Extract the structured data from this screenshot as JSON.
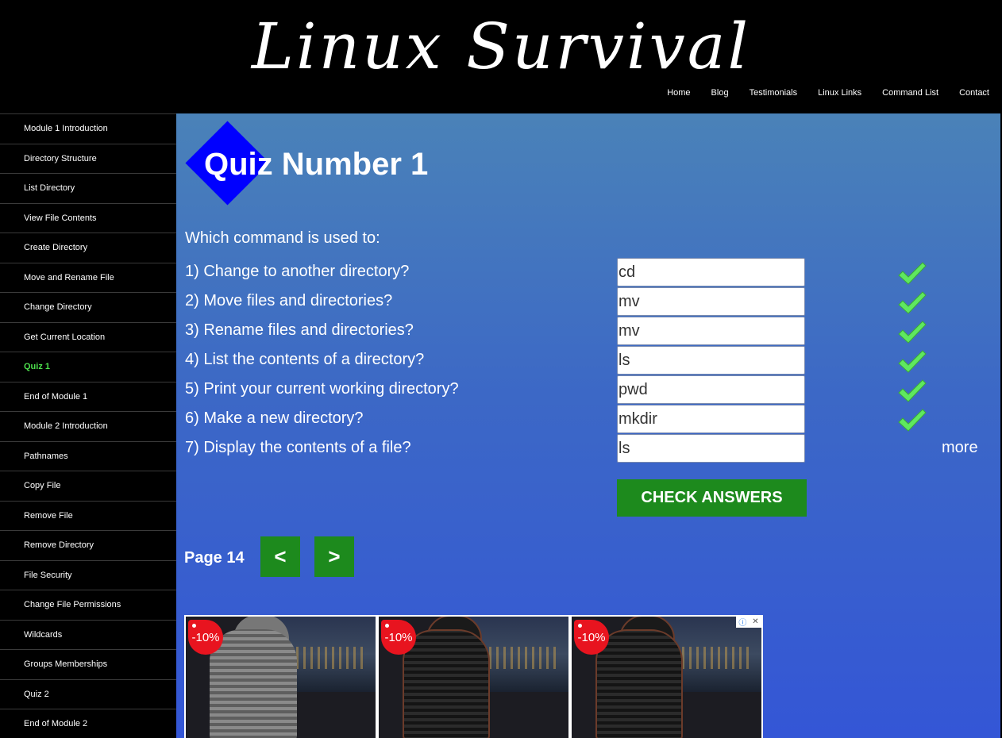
{
  "site": {
    "title": "Linux Survival"
  },
  "nav": [
    "Home",
    "Blog",
    "Testimonials",
    "Linux Links",
    "Command List",
    "Contact"
  ],
  "sidebar": [
    {
      "label": "Module 1 Introduction",
      "active": false
    },
    {
      "label": "Directory Structure",
      "active": false
    },
    {
      "label": "List Directory",
      "active": false
    },
    {
      "label": "View File Contents",
      "active": false
    },
    {
      "label": "Create Directory",
      "active": false
    },
    {
      "label": "Move and Rename File",
      "active": false
    },
    {
      "label": "Change Directory",
      "active": false
    },
    {
      "label": "Get Current Location",
      "active": false
    },
    {
      "label": "Quiz 1",
      "active": true
    },
    {
      "label": "End of Module 1",
      "active": false
    },
    {
      "label": "Module 2 Introduction",
      "active": false
    },
    {
      "label": "Pathnames",
      "active": false
    },
    {
      "label": "Copy File",
      "active": false
    },
    {
      "label": "Remove File",
      "active": false
    },
    {
      "label": "Remove Directory",
      "active": false
    },
    {
      "label": "File Security",
      "active": false
    },
    {
      "label": "Change File Permissions",
      "active": false
    },
    {
      "label": "Wildcards",
      "active": false
    },
    {
      "label": "Groups Memberships",
      "active": false
    },
    {
      "label": "Quiz 2",
      "active": false
    },
    {
      "label": "End of Module 2",
      "active": false
    }
  ],
  "quiz": {
    "title": "Quiz Number 1",
    "prompt": "Which command is used to:",
    "questions": [
      {
        "text": "1) Change to another directory?",
        "answer": "cd",
        "correct": true
      },
      {
        "text": "2) Move files and directories?",
        "answer": "mv",
        "correct": true
      },
      {
        "text": "3) Rename files and directories?",
        "answer": "mv",
        "correct": true
      },
      {
        "text": "4) List the contents of a directory?",
        "answer": "ls",
        "correct": true
      },
      {
        "text": "5) Print your current working directory?",
        "answer": "pwd",
        "correct": true
      },
      {
        "text": "6) Make a new directory?",
        "answer": "mkdir",
        "correct": true
      },
      {
        "text": "7) Display the contents of a file?",
        "answer": "ls",
        "correct": false,
        "more": "more"
      }
    ],
    "check_label": "CHECK ANSWERS"
  },
  "pager": {
    "label": "Page 14",
    "prev": "<",
    "next": ">"
  },
  "ad": {
    "cards": [
      {
        "discount": "-10%",
        "seat": "grey"
      },
      {
        "discount": "-10%",
        "seat": "black"
      },
      {
        "discount": "-10%",
        "seat": "black"
      }
    ]
  },
  "colors": {
    "accent_green": "#1d8a1d",
    "active_link": "#4cde4c",
    "check_mark": "#5fe85f",
    "diamond": "#0000ff"
  }
}
